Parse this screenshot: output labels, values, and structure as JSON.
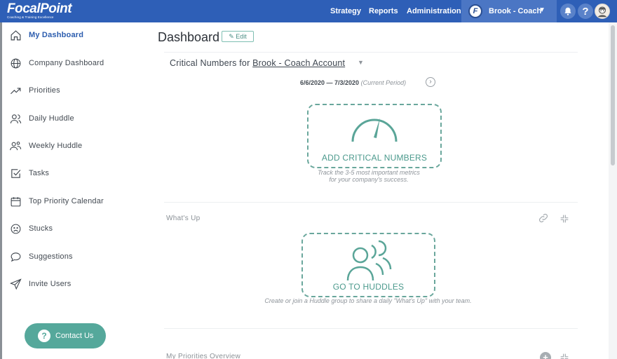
{
  "brand": {
    "name": "FocalPoint",
    "tagline": "Coaching & Training Excellence"
  },
  "topnav": {
    "links": [
      "Strategy",
      "Reports",
      "Administration"
    ],
    "user": {
      "initial": "F",
      "name": "Brook - Coach"
    }
  },
  "sidebar": {
    "items": [
      {
        "label": "My Dashboard",
        "icon": "home-icon",
        "active": true
      },
      {
        "label": "Company Dashboard",
        "icon": "globe-icon"
      },
      {
        "label": "Priorities",
        "icon": "trend-up-icon"
      },
      {
        "label": "Daily Huddle",
        "icon": "users-icon"
      },
      {
        "label": "Weekly Huddle",
        "icon": "group-icon"
      },
      {
        "label": "Tasks",
        "icon": "checkbox-icon"
      },
      {
        "label": "Top Priority Calendar",
        "icon": "calendar-icon"
      },
      {
        "label": "Stucks",
        "icon": "frown-icon"
      },
      {
        "label": "Suggestions",
        "icon": "speech-bubble-icon"
      },
      {
        "label": "Invite Users",
        "icon": "send-icon"
      }
    ],
    "contact": {
      "label": "Contact Us",
      "icon_glyph": "?"
    }
  },
  "main": {
    "title": "Dashboard",
    "edit_label": "Edit",
    "critical_numbers": {
      "prefix": "Critical Numbers for",
      "account": "Brook - Coach Account",
      "period_range": "6/6/2020 — 7/3/2020",
      "period_note": "(Current Period)",
      "add_label": "ADD CRITICAL NUMBERS",
      "hint_line1": "Track the 3-5 most important metrics",
      "hint_line2": "for your company's success."
    },
    "whats_up": {
      "title": "What's Up",
      "cta_label": "GO TO HUDDLES",
      "hint": "Create or join a Huddle group to share a daily \"What's Up\" with your team."
    },
    "priorities_overview": {
      "title": "My Priorities Overview"
    }
  },
  "colors": {
    "topbar": "#2e5fb7",
    "accent_teal": "#55a89b",
    "active_blue": "#2b5cae"
  }
}
